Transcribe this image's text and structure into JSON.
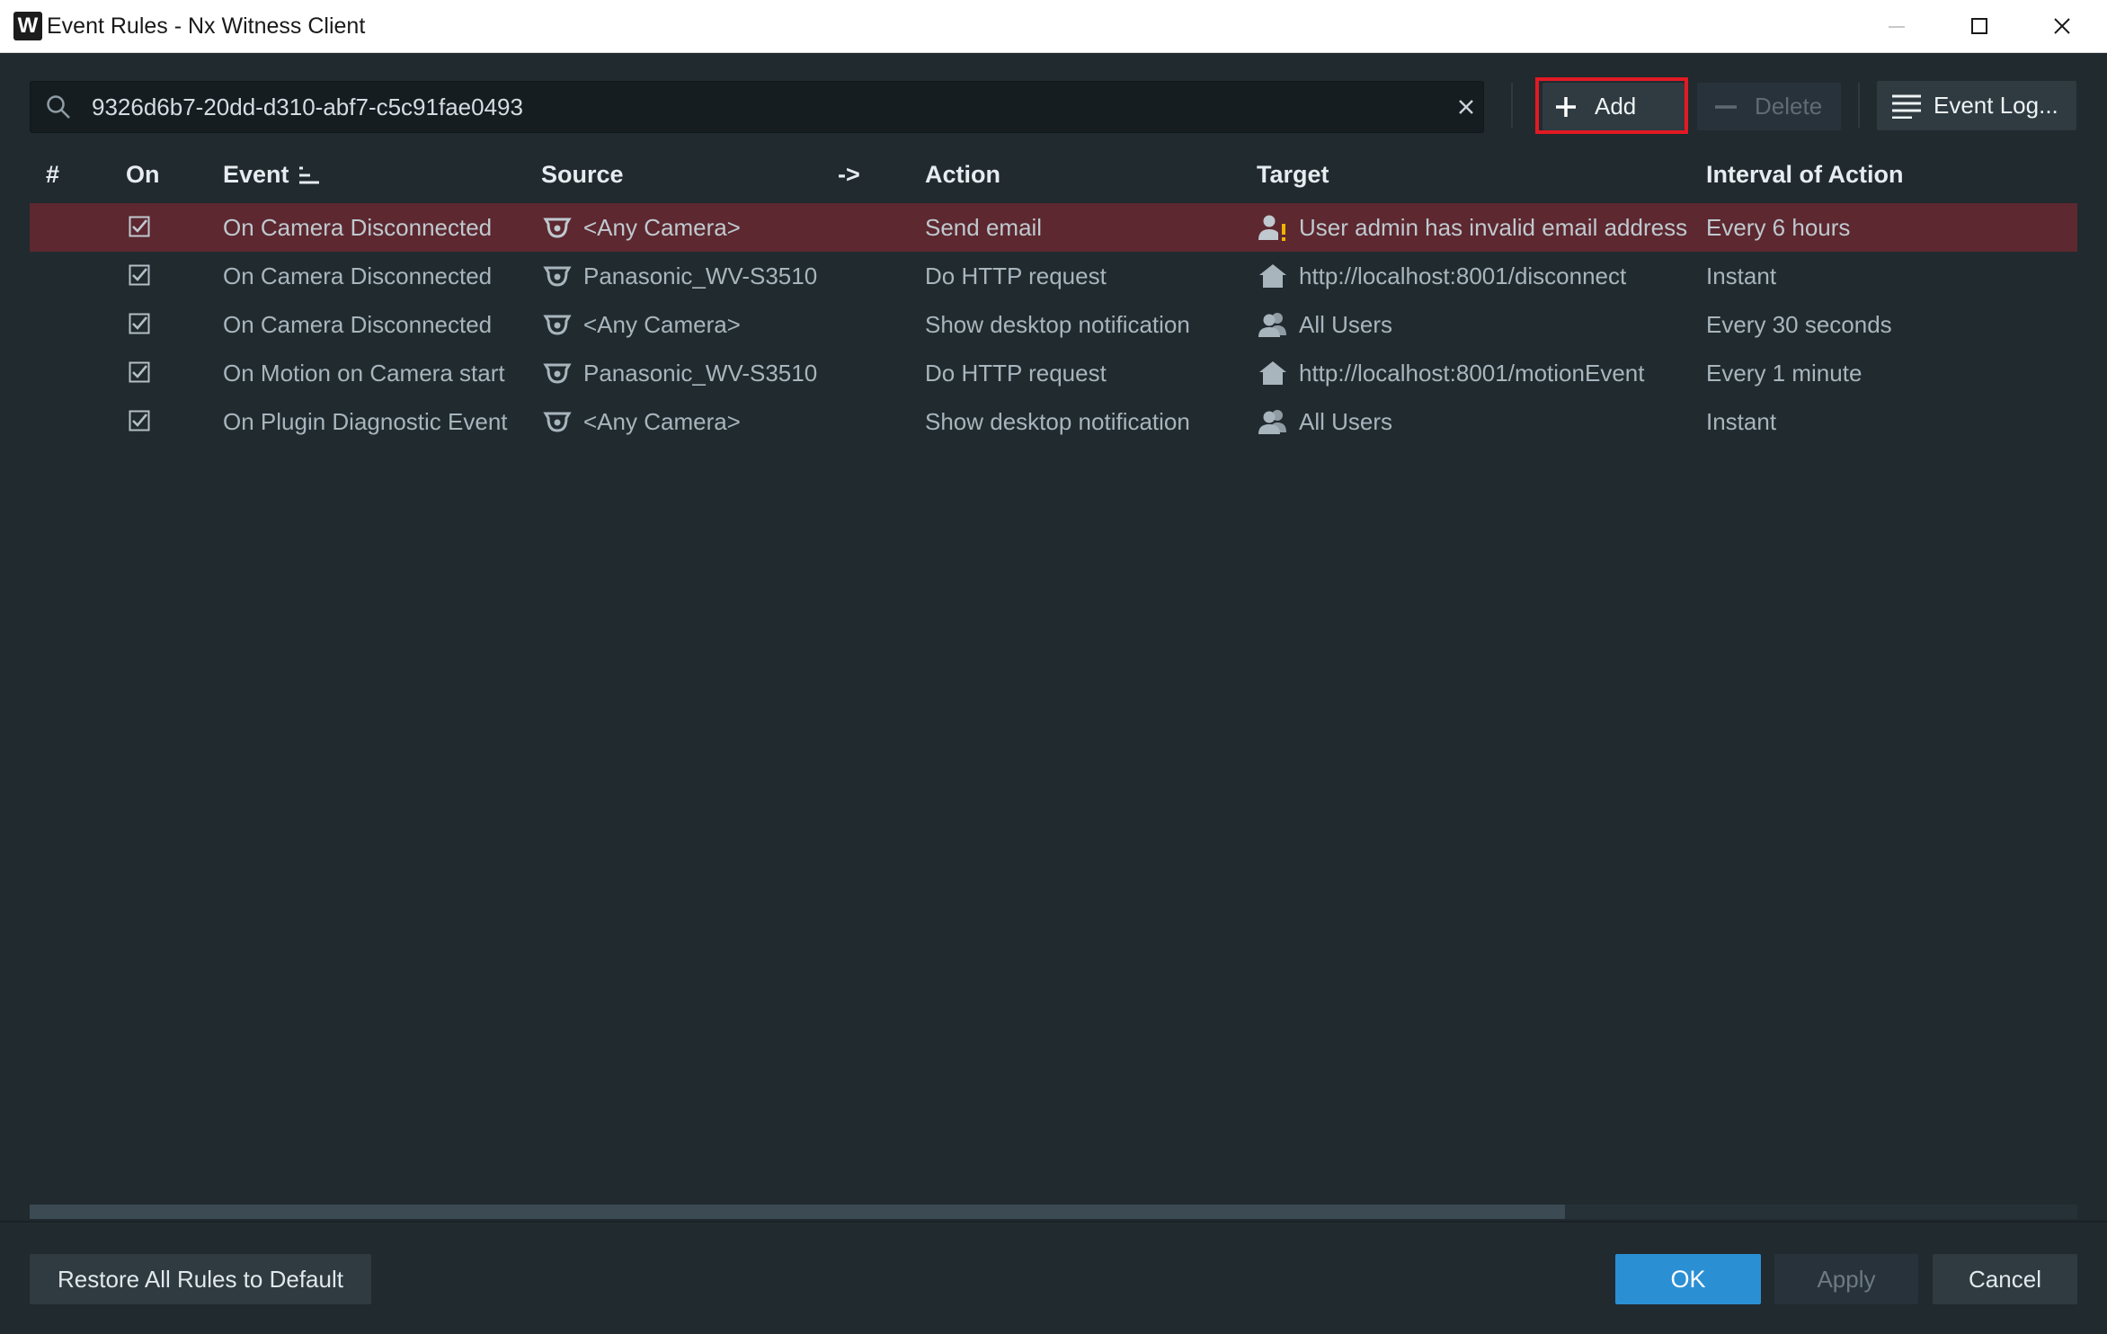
{
  "window": {
    "title": "Event Rules - Nx Witness Client",
    "logo_letter": "W"
  },
  "search": {
    "value": "9326d6b7-20dd-d310-abf7-c5c91fae0493"
  },
  "toolbar": {
    "add_label": "Add",
    "delete_label": "Delete",
    "event_log_label": "Event Log..."
  },
  "table": {
    "columns": {
      "num": "#",
      "on": "On",
      "event": "Event",
      "source": "Source",
      "arrow": "->",
      "action": "Action",
      "target": "Target",
      "interval": "Interval of Action"
    },
    "rows": [
      {
        "on": true,
        "event": "On Camera Disconnected",
        "source": "<Any Camera>",
        "action": "Send email",
        "target_icon": "user-warning-icon",
        "target": "User admin has invalid email address",
        "interval": "Every 6 hours",
        "selected": true
      },
      {
        "on": true,
        "event": "On Camera Disconnected",
        "source": "Panasonic_WV-S3510",
        "action": "Do HTTP request",
        "target_icon": "server-icon",
        "target": "http://localhost:8001/disconnect",
        "interval": "Instant",
        "selected": false
      },
      {
        "on": true,
        "event": "On Camera Disconnected",
        "source": "<Any Camera>",
        "action": "Show desktop notification",
        "target_icon": "users-icon",
        "target": "All Users",
        "interval": "Every 30 seconds",
        "selected": false
      },
      {
        "on": true,
        "event": "On Motion on Camera start",
        "source": "Panasonic_WV-S3510",
        "action": "Do HTTP request",
        "target_icon": "server-icon",
        "target": "http://localhost:8001/motionEvent",
        "interval": "Every 1 minute",
        "selected": false
      },
      {
        "on": true,
        "event": "On Plugin Diagnostic Event",
        "source": "<Any Camera>",
        "action": "Show desktop notification",
        "target_icon": "users-icon",
        "target": "All Users",
        "interval": "Instant",
        "selected": false
      }
    ]
  },
  "footer": {
    "restore_label": "Restore All Rules to Default",
    "ok_label": "OK",
    "apply_label": "Apply",
    "cancel_label": "Cancel"
  },
  "colors": {
    "background": "#212a2f",
    "selected_row": "#5d2830",
    "accent": "#2b8fd4",
    "highlight": "#e21a24"
  }
}
